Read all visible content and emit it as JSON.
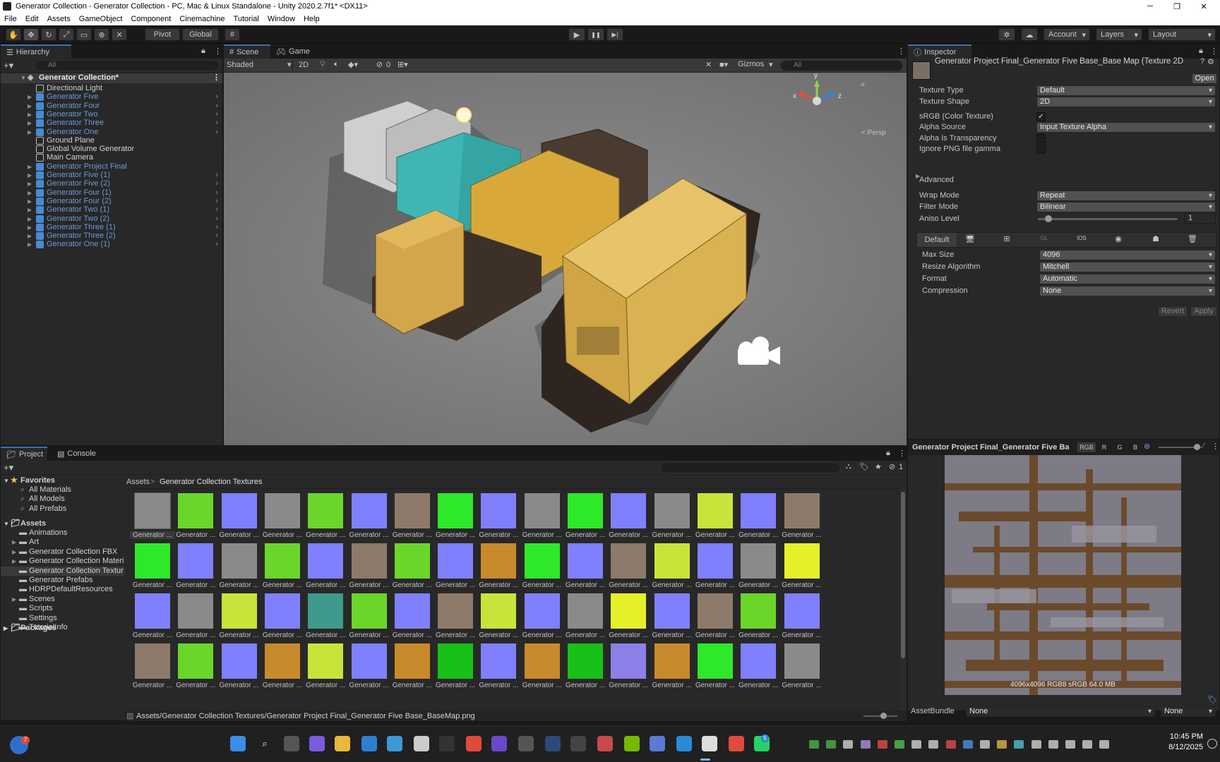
{
  "window": {
    "title": "Generator Collection - Generator Collection - PC, Mac & Linux Standalone - Unity 2020.2.7f1* <DX11>",
    "minimize": "─",
    "maximize": "❐",
    "close": "✕"
  },
  "menu": [
    "File",
    "Edit",
    "Assets",
    "GameObject",
    "Component",
    "Cinemachine",
    "Tutorial",
    "Window",
    "Help"
  ],
  "toolbar": {
    "pivot": "Pivot",
    "global": "Global",
    "play": "▶",
    "pause": "❚❚",
    "step": "▶|",
    "account": "Account",
    "layers": "Layers",
    "layout": "Layout"
  },
  "hierarchy": {
    "tab": "Hierarchy",
    "search_placeholder": "All",
    "root": "Generator Collection*",
    "items": [
      {
        "label": "Directional Light",
        "type": "plain",
        "expandable": false
      },
      {
        "label": "Generator Five",
        "type": "prefab",
        "expandable": true
      },
      {
        "label": "Generator Four",
        "type": "prefab",
        "expandable": true
      },
      {
        "label": "Generator Two",
        "type": "prefab",
        "expandable": true
      },
      {
        "label": "Generator Three",
        "type": "prefab",
        "expandable": true
      },
      {
        "label": "Generator One",
        "type": "prefab",
        "expandable": true
      },
      {
        "label": "Ground Plane",
        "type": "plain",
        "expandable": false
      },
      {
        "label": "Global Volume Generator",
        "type": "plain",
        "expandable": false
      },
      {
        "label": "Main Camera",
        "type": "plain",
        "expandable": false
      },
      {
        "label": "Generator Project Final",
        "type": "selected",
        "expandable": true
      },
      {
        "label": "Generator Five (1)",
        "type": "prefab",
        "expandable": true
      },
      {
        "label": "Generator Five (2)",
        "type": "prefab",
        "expandable": true
      },
      {
        "label": "Generator Four (1)",
        "type": "prefab",
        "expandable": true
      },
      {
        "label": "Generator Four (2)",
        "type": "prefab",
        "expandable": true
      },
      {
        "label": "Generator Two (1)",
        "type": "prefab",
        "expandable": true
      },
      {
        "label": "Generator Two (2)",
        "type": "prefab",
        "expandable": true
      },
      {
        "label": "Generator Three (1)",
        "type": "prefab",
        "expandable": true
      },
      {
        "label": "Generator Three (2)",
        "type": "prefab",
        "expandable": true
      },
      {
        "label": "Generator One (1)",
        "type": "prefab",
        "expandable": true
      }
    ]
  },
  "scene": {
    "tab_scene": "Scene",
    "tab_game": "Game",
    "shading": "Shaded",
    "mode2d": "2D",
    "hidden_count": "0",
    "gizmos": "Gizmos",
    "search_placeholder": "All",
    "gizmo_y": "y",
    "gizmo_x": "x",
    "gizmo_z": "z",
    "persp": "< Persp"
  },
  "inspector": {
    "tab": "Inspector",
    "asset_title": "Generator Project Final_Generator Five Base_Base Map (Texture 2D",
    "open": "Open",
    "props": [
      {
        "label": "Texture Type",
        "value": "Default",
        "kind": "dropdown"
      },
      {
        "label": "Texture Shape",
        "value": "2D",
        "kind": "dropdown"
      },
      {
        "label": "sRGB (Color Texture)",
        "value": "✓",
        "kind": "check"
      },
      {
        "label": "Alpha Source",
        "value": "Input Texture Alpha",
        "kind": "dropdown"
      },
      {
        "label": "Alpha Is Transparency",
        "value": "",
        "kind": "check"
      },
      {
        "label": "Ignore PNG file gamma",
        "value": "",
        "kind": "check"
      }
    ],
    "advanced": "Advanced",
    "props2": [
      {
        "label": "Wrap Mode",
        "value": "Repeat"
      },
      {
        "label": "Filter Mode",
        "value": "Bilinear"
      }
    ],
    "aniso_label": "Aniso Level",
    "aniso_value": "1",
    "platform_default": "Default",
    "platform_tabs": [
      "monitor-icon",
      "windows-icon",
      "webgl-icon",
      "ios-icon",
      "ps-icon",
      "android-icon",
      "trash-icon"
    ],
    "platform_ios": "iOS",
    "platform_webgl": "GL",
    "props3": [
      {
        "label": "Max Size",
        "value": "4096"
      },
      {
        "label": "Resize Algorithm",
        "value": "Mitchell"
      },
      {
        "label": "Format",
        "value": "Automatic"
      },
      {
        "label": "Compression",
        "value": "None"
      }
    ],
    "revert": "Revert",
    "apply": "Apply"
  },
  "preview": {
    "title": "Generator Project Final_Generator Five Bas",
    "channels": [
      "RGB",
      "R",
      "G",
      "B"
    ],
    "info": "4096x4096  RGB8 sRGB  64.0 MB",
    "assetbundle_label": "AssetBundle",
    "assetbundle_value": "None",
    "variant_value": "None"
  },
  "project": {
    "tab_project": "Project",
    "tab_console": "Console",
    "favorites": "Favorites",
    "favorites_items": [
      "All Materials",
      "All Models",
      "All Prefabs"
    ],
    "assets": "Assets",
    "folders": [
      "Animations",
      "Art",
      "Generator Collection FBX",
      "Generator Collection Materi",
      "Generator Collection Textur",
      "Generator Prefabs",
      "HDRPDefaultResources",
      "Scenes",
      "Scripts",
      "Settings",
      "TutorialInfo"
    ],
    "packages": "Packages",
    "breadcrumb": [
      "Assets",
      "Generator Collection Textures"
    ],
    "item_label": "Generator ...",
    "hidden_count": "1",
    "status_path": "Assets/Generator Collection Textures/Generator Project Final_Generator Five Base_BaseMap.png",
    "textures": [
      "gray",
      "green",
      "blue",
      "gray",
      "green",
      "blue",
      "rust",
      "brightgreen",
      "blue",
      "gray",
      "brightgreen",
      "blue",
      "gray",
      "yellowgreen",
      "blue",
      "rust",
      "brightgreen",
      "blue",
      "gray",
      "green",
      "blue",
      "rust",
      "green",
      "blue",
      "orange",
      "brightgreen",
      "blue",
      "rust",
      "yellowgreen",
      "blue",
      "gray",
      "yellow",
      "blue",
      "gray",
      "yellowgreen",
      "blue",
      "teal",
      "green",
      "blue",
      "rust",
      "yellowgreen",
      "blue",
      "gray",
      "yellow",
      "blue",
      "rust",
      "green",
      "blue",
      "rust",
      "green",
      "blue",
      "orange",
      "yellowgreen",
      "blue",
      "orange",
      "darkgreen",
      "blue",
      "orange",
      "darkgreen",
      "purple",
      "orange",
      "brightgreen",
      "blue",
      "gray"
    ]
  },
  "taskbar": {
    "time": "10:45 PM",
    "date": "8/12/2025",
    "badge": "7",
    "whatsapp_badge": "5"
  },
  "colors": {
    "accent": "#3a72b0",
    "prefab": "#6d99d6",
    "panel": "#282828",
    "dark": "#191919",
    "selection": "#2c5d87"
  }
}
